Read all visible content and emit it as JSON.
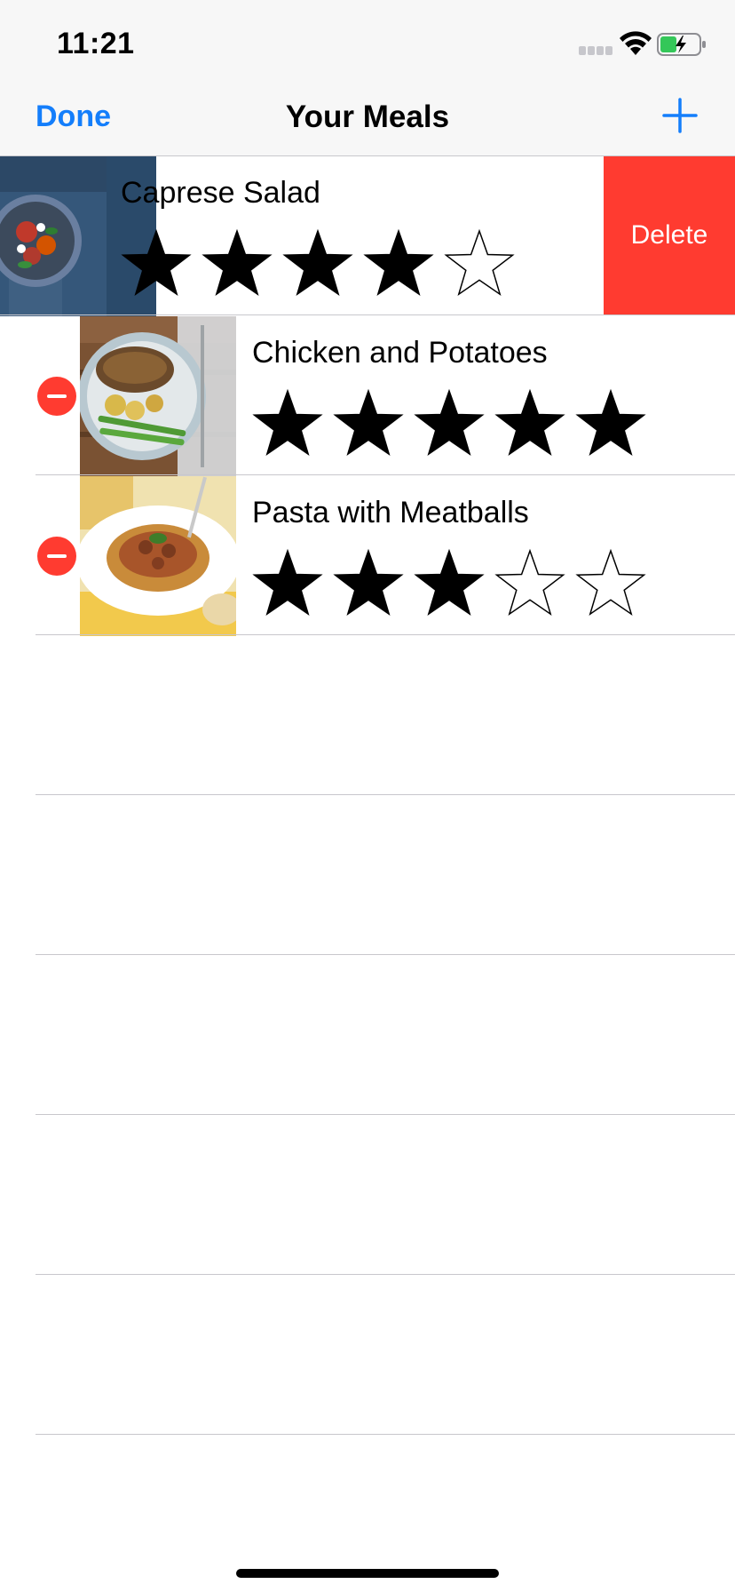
{
  "status_bar": {
    "time": "11:21",
    "icons": [
      "cellular-signal-icon",
      "wifi-icon",
      "battery-charging-icon"
    ]
  },
  "nav": {
    "left_button": "Done",
    "title": "Your Meals",
    "right_icon": "plus-icon"
  },
  "meals": [
    {
      "name": "Caprese Salad",
      "rating": 4,
      "max_rating": 5,
      "swiped": true
    },
    {
      "name": "Chicken and Potatoes",
      "rating": 5,
      "max_rating": 5,
      "swiped": false
    },
    {
      "name": "Pasta with Meatballs",
      "rating": 3,
      "max_rating": 5,
      "swiped": false
    }
  ],
  "swipe_action": {
    "label": "Delete"
  },
  "colors": {
    "accent": "#147efb",
    "destructive": "#ff3b30",
    "separator": "#c8c7cc",
    "bar_background": "#f7f7f7"
  }
}
